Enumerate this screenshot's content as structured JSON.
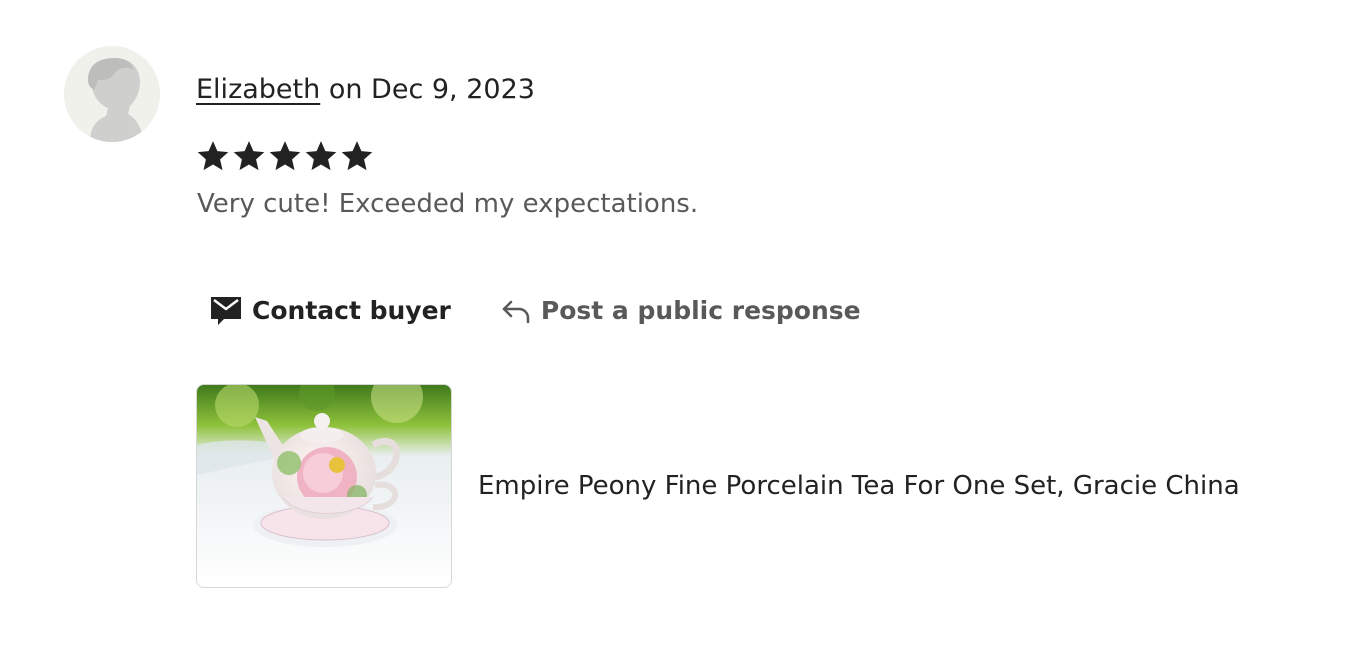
{
  "reviewer": {
    "name": "Elizabeth",
    "date_text": "on Dec 9, 2023",
    "avatar_icon": "default-avatar-silhouette"
  },
  "rating": {
    "stars": 5,
    "max": 5,
    "star_color": "#222222"
  },
  "review": {
    "text": "Very cute! Exceeded my expectations."
  },
  "actions": {
    "contact_label": "Contact buyer",
    "contact_icon": "envelope-message-icon",
    "respond_label": "Post a public response",
    "respond_icon": "reply-arrow-icon"
  },
  "product": {
    "title": "Empire Peony Fine Porcelain Tea For One Set, Gracie China",
    "image": "teapot-photo"
  }
}
